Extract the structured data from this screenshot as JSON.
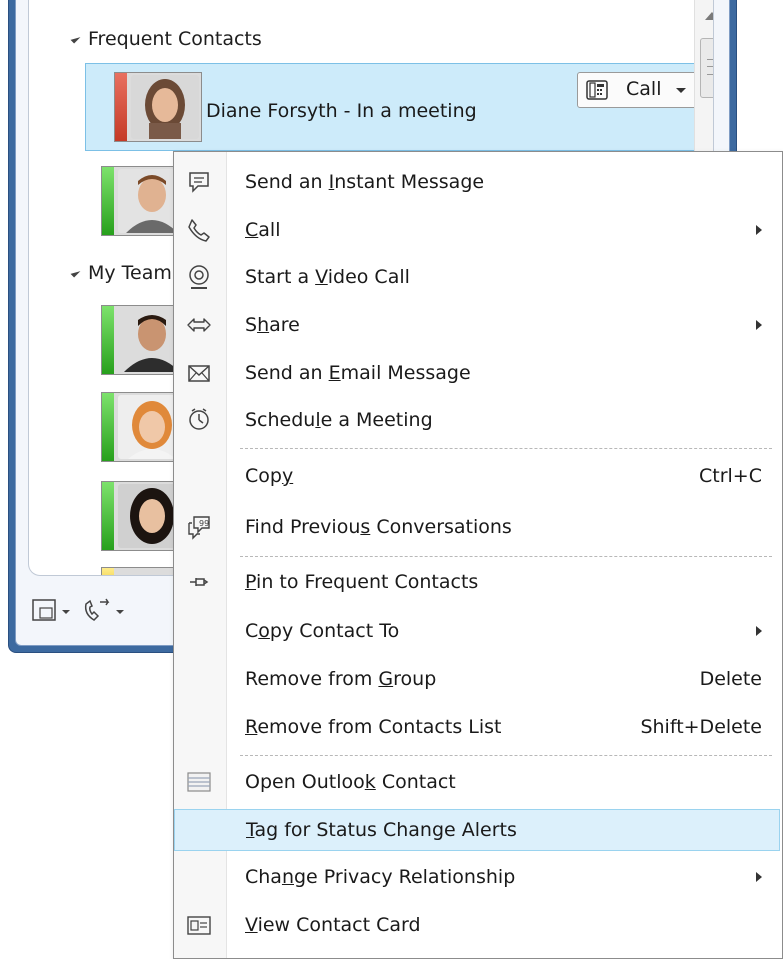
{
  "contacts_window": {
    "groups": [
      {
        "name": "Frequent Contacts"
      },
      {
        "name": "My Team"
      }
    ],
    "selected_contact": {
      "name": "Diane Forsyth - In a meeting",
      "status_color": "#d0452f",
      "call_button_label": "Call"
    },
    "toolbar_icons": [
      "conversation-icon",
      "phone-forward-icon"
    ]
  },
  "context_menu": {
    "items": [
      {
        "pre": "Send an ",
        "u": "I",
        "post": "nstant Message",
        "icon": "chat-bubble-icon"
      },
      {
        "pre": "",
        "u": "C",
        "post": "all",
        "icon": "phone-icon",
        "submenu": true
      },
      {
        "pre": "Start a ",
        "u": "V",
        "post": "ideo Call",
        "icon": "webcam-icon"
      },
      {
        "pre": "S",
        "u": "h",
        "post": "are",
        "icon": "share-arrows-icon",
        "submenu": true
      },
      {
        "pre": "Send an ",
        "u": "E",
        "post": "mail Message",
        "icon": "envelope-icon"
      },
      {
        "pre": "Schedu",
        "u": "l",
        "post": "e a Meeting",
        "icon": "meeting-clock-icon"
      },
      {
        "pre": "Cop",
        "u": "y",
        "post": "",
        "shortcut": "Ctrl+C"
      },
      {
        "pre": "Find Previou",
        "u": "s",
        "post": " Conversations",
        "icon": "conversation-history-icon"
      },
      {
        "pre": "",
        "u": "P",
        "post": "in to Frequent Contacts",
        "icon": "pin-icon"
      },
      {
        "pre": "C",
        "u": "o",
        "post": "py Contact To",
        "submenu": true
      },
      {
        "pre": "Remove from ",
        "u": "G",
        "post": "roup",
        "shortcut": "Delete"
      },
      {
        "pre": "",
        "u": "R",
        "post": "emove from Contacts List",
        "shortcut": "Shift+Delete"
      },
      {
        "pre": "Open Outloo",
        "u": "k",
        "post": " Contact",
        "icon": "outlook-contact-icon"
      },
      {
        "pre": "",
        "u": "T",
        "post": "ag for Status Change Alerts",
        "highlighted": true
      },
      {
        "pre": "Cha",
        "u": "n",
        "post": "ge Privacy Relationship",
        "submenu": true
      },
      {
        "pre": "",
        "u": "V",
        "post": "iew Contact Card",
        "icon": "contact-card-icon"
      }
    ]
  }
}
